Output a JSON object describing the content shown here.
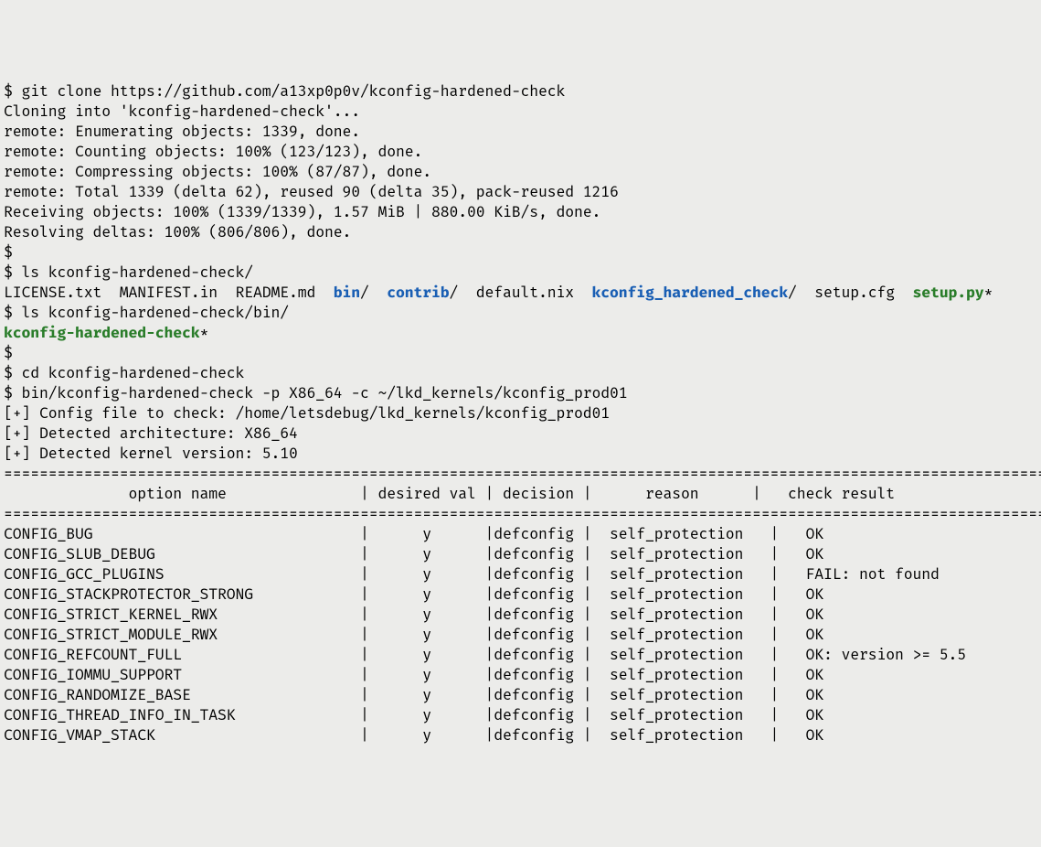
{
  "lines": [
    {
      "segments": [
        {
          "text": "$ git clone https://github.com/a13xp0p0v/kconfig-hardened-check"
        }
      ]
    },
    {
      "segments": [
        {
          "text": "Cloning into 'kconfig-hardened-check'..."
        }
      ]
    },
    {
      "segments": [
        {
          "text": "remote: Enumerating objects: 1339, done."
        }
      ]
    },
    {
      "segments": [
        {
          "text": "remote: Counting objects: 100% (123/123), done."
        }
      ]
    },
    {
      "segments": [
        {
          "text": "remote: Compressing objects: 100% (87/87), done."
        }
      ]
    },
    {
      "segments": [
        {
          "text": "remote: Total 1339 (delta 62), reused 90 (delta 35), pack-reused 1216"
        }
      ]
    },
    {
      "segments": [
        {
          "text": "Receiving objects: 100% (1339/1339), 1.57 MiB | 880.00 KiB/s, done."
        }
      ]
    },
    {
      "segments": [
        {
          "text": "Resolving deltas: 100% (806/806), done."
        }
      ]
    },
    {
      "segments": [
        {
          "text": "$"
        }
      ]
    },
    {
      "segments": [
        {
          "text": "$ ls kconfig-hardened-check/"
        }
      ]
    },
    {
      "segments": [
        {
          "text": "LICENSE.txt  MANIFEST.in  README.md  "
        },
        {
          "text": "bin",
          "cls": "dir"
        },
        {
          "text": "/  "
        },
        {
          "text": "contrib",
          "cls": "dir"
        },
        {
          "text": "/  default.nix  "
        },
        {
          "text": "kconfig_hardened_check",
          "cls": "dir"
        },
        {
          "text": "/  setup.cfg  "
        },
        {
          "text": "setup.py",
          "cls": "exec"
        },
        {
          "text": "*"
        }
      ]
    },
    {
      "segments": [
        {
          "text": "$ ls kconfig-hardened-check/bin/"
        }
      ]
    },
    {
      "segments": [
        {
          "text": "kconfig-hardened-check",
          "cls": "exec"
        },
        {
          "text": "*"
        }
      ]
    },
    {
      "segments": [
        {
          "text": "$"
        }
      ]
    },
    {
      "segments": [
        {
          "text": "$ cd kconfig-hardened-check"
        }
      ]
    },
    {
      "segments": [
        {
          "text": "$ bin/kconfig-hardened-check -p X86_64 -c ~/lkd_kernels/kconfig_prod01"
        }
      ]
    },
    {
      "segments": [
        {
          "text": "[+] Config file to check: /home/letsdebug/lkd_kernels/kconfig_prod01"
        }
      ]
    },
    {
      "segments": [
        {
          "text": "[+] Detected architecture: X86_64"
        }
      ]
    },
    {
      "segments": [
        {
          "text": "[+] Detected kernel version: 5.10"
        }
      ]
    },
    {
      "segments": [
        {
          "text": "================================================================================================================================="
        }
      ]
    },
    {
      "segments": [
        {
          "text": "              option name               | desired val | decision |      reason      |   check result"
        }
      ]
    },
    {
      "segments": [
        {
          "text": "================================================================================================================================="
        }
      ]
    },
    {
      "segments": [
        {
          "text": "CONFIG_BUG                              |      y      |defconfig |  self_protection   |   OK"
        }
      ]
    },
    {
      "segments": [
        {
          "text": "CONFIG_SLUB_DEBUG                       |      y      |defconfig |  self_protection   |   OK"
        }
      ]
    },
    {
      "segments": [
        {
          "text": "CONFIG_GCC_PLUGINS                      |      y      |defconfig |  self_protection   |   FAIL: not found"
        }
      ]
    },
    {
      "segments": [
        {
          "text": "CONFIG_STACKPROTECTOR_STRONG            |      y      |defconfig |  self_protection   |   OK"
        }
      ]
    },
    {
      "segments": [
        {
          "text": "CONFIG_STRICT_KERNEL_RWX                |      y      |defconfig |  self_protection   |   OK"
        }
      ]
    },
    {
      "segments": [
        {
          "text": "CONFIG_STRICT_MODULE_RWX                |      y      |defconfig |  self_protection   |   OK"
        }
      ]
    },
    {
      "segments": [
        {
          "text": "CONFIG_REFCOUNT_FULL                    |      y      |defconfig |  self_protection   |   OK: version >= 5.5"
        }
      ]
    },
    {
      "segments": [
        {
          "text": "CONFIG_IOMMU_SUPPORT                    |      y      |defconfig |  self_protection   |   OK"
        }
      ]
    },
    {
      "segments": [
        {
          "text": "CONFIG_RANDOMIZE_BASE                   |      y      |defconfig |  self_protection   |   OK"
        }
      ]
    },
    {
      "segments": [
        {
          "text": "CONFIG_THREAD_INFO_IN_TASK              |      y      |defconfig |  self_protection   |   OK"
        }
      ]
    },
    {
      "segments": [
        {
          "text": "CONFIG_VMAP_STACK                       |      y      |defconfig |  self_protection   |   OK"
        }
      ]
    }
  ]
}
